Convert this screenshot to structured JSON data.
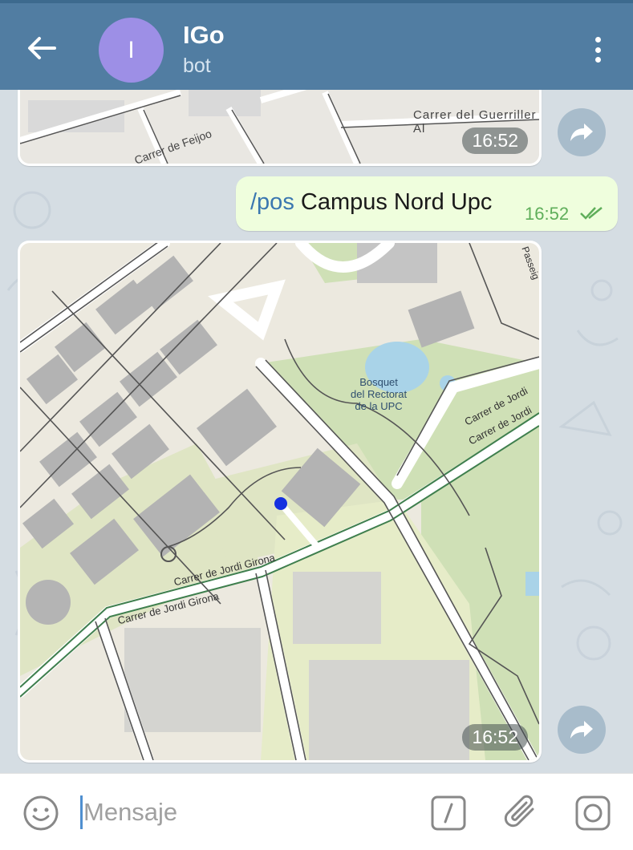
{
  "header": {
    "avatar_letter": "I",
    "title": "IGo",
    "subtitle": "bot",
    "colors": {
      "bar": "#517da2",
      "avatar": "#9d8fe6"
    }
  },
  "messages": {
    "first_map": {
      "time": "16:52",
      "street_labels": [
        "Carrer del Guerriller Al",
        "Carrer de Feijoo"
      ]
    },
    "outgoing": {
      "command": "/pos",
      "text": "Campus Nord Upc",
      "time": "16:52"
    },
    "second_map": {
      "time": "16:52",
      "street_labels": [
        "Carrer de Jordi",
        "Carrer de Jordi",
        "Carrer de Jordi Girona",
        "Carrer de Jordi Girona",
        "Passeig"
      ],
      "poi_label": [
        "Bosquet",
        "del Rectorat",
        "de la UPC"
      ]
    }
  },
  "input": {
    "placeholder": "Mensaje",
    "icons": [
      "smile-icon",
      "slash-command-icon",
      "paperclip-icon",
      "camera-icon"
    ]
  }
}
